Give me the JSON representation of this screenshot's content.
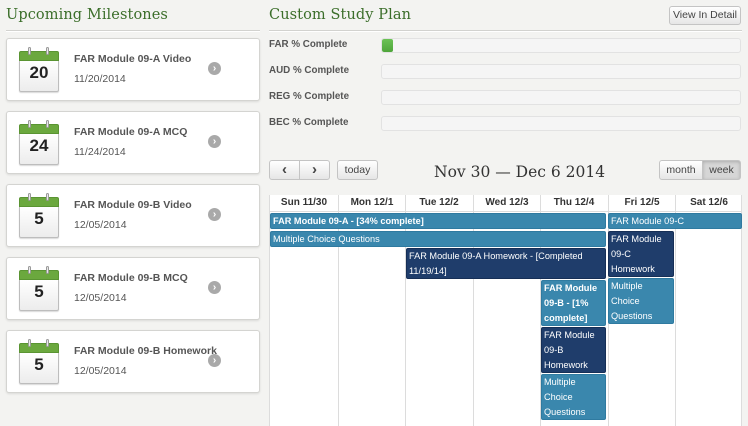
{
  "milestones": {
    "title": "Upcoming Milestones",
    "items": [
      {
        "day": "20",
        "title": "FAR Module 09-A Video",
        "date": "11/20/2014"
      },
      {
        "day": "24",
        "title": "FAR Module 09-A MCQ",
        "date": "11/24/2014"
      },
      {
        "day": "5",
        "title": "FAR Module 09-B Video",
        "date": "12/05/2014"
      },
      {
        "day": "5",
        "title": "FAR Module 09-B MCQ",
        "date": "12/05/2014"
      },
      {
        "day": "5",
        "title": "FAR Module 09-B Homework",
        "date": "12/05/2014"
      }
    ]
  },
  "study_plan": {
    "title": "Custom Study Plan",
    "view_detail_label": "View In Detail",
    "progress": [
      {
        "label": "FAR % Complete",
        "percent": 3
      },
      {
        "label": "AUD % Complete",
        "percent": 0
      },
      {
        "label": "REG % Complete",
        "percent": 0
      },
      {
        "label": "BEC % Complete",
        "percent": 0
      }
    ],
    "colors": {
      "accent_green": "#3b6e2a",
      "progress_green": "#5cb547",
      "event_teal": "#3a87ad",
      "event_navy": "#1f3d6b"
    }
  },
  "calendar": {
    "prev_icon": "chevron-left-icon",
    "next_icon": "chevron-right-icon",
    "prev_label": "‹",
    "next_label": "›",
    "today_label": "today",
    "title": "Nov 30 — Dec 6 2014",
    "view_month_label": "month",
    "view_week_label": "week",
    "active_view": "week",
    "days": [
      "Sun 11/30",
      "Mon 12/1",
      "Tue 12/2",
      "Wed 12/3",
      "Thu 12/4",
      "Fri 12/5",
      "Sat 12/6"
    ],
    "events": {
      "far_09a": "FAR Module 09-A - [34% complete]",
      "mcq_span": "Multiple Choice Questions",
      "homework_09a": "FAR Module 09-A Homework - [Completed 11/19/14]",
      "far_09b": "FAR Module 09-B - [1% complete]",
      "homework_09b": "FAR Module 09-B Homework",
      "mcq_thu": "Multiple Choice Questions",
      "far_09c": "FAR Module 09-C",
      "homework_09c": "FAR Module 09-C Homework",
      "mcq_fri": "Multiple Choice Questions"
    }
  }
}
